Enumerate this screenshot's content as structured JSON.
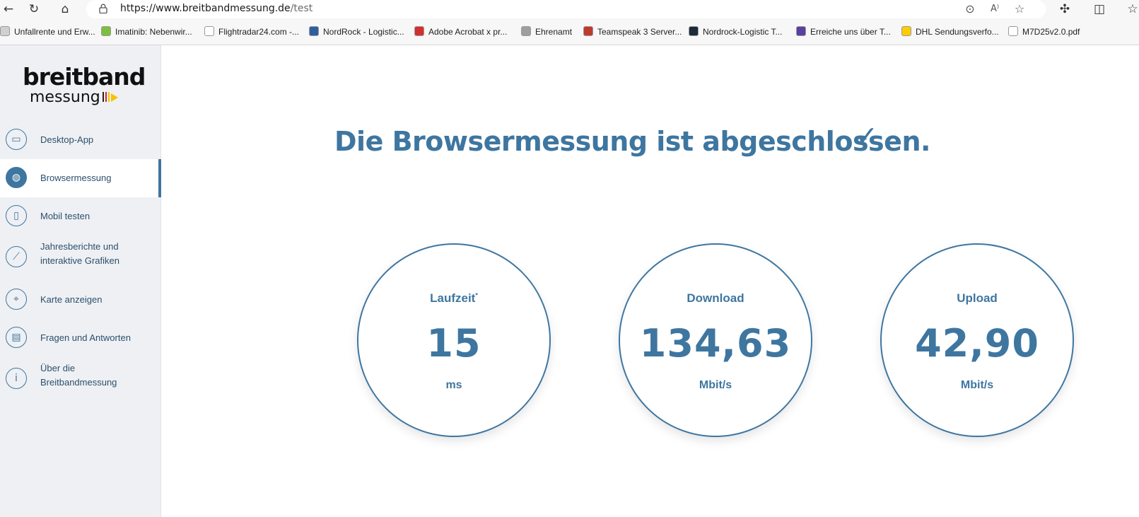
{
  "browser": {
    "url_host": "https://www.breitbandmessung.de",
    "url_path": "/test",
    "bookmarks": [
      {
        "label": "Unfallrente und Erw...",
        "color": "#d0d0d0"
      },
      {
        "label": "Imatinib: Nebenwir...",
        "color": "#7fbf3f"
      },
      {
        "label": "Flightradar24.com -...",
        "color": "#ffffff"
      },
      {
        "label": "NordRock - Logistic...",
        "color": "#2d5fa0"
      },
      {
        "label": "Adobe Acrobat x pr...",
        "color": "#d32f2f"
      },
      {
        "label": "Ehrenamt",
        "color": "#9e9e9e"
      },
      {
        "label": "Teamspeak 3 Server...",
        "color": "#c0392b"
      },
      {
        "label": "Nordrock-Logistic T...",
        "color": "#1b2b3a"
      },
      {
        "label": "Erreiche uns über T...",
        "color": "#5b3fa0"
      },
      {
        "label": "DHL Sendungsverfo...",
        "color": "#ffcc00"
      },
      {
        "label": "M7D25v2.0.pdf",
        "color": "#ffffff"
      }
    ]
  },
  "sidebar": {
    "logo_top": "breitband",
    "logo_bottom": "messung",
    "items": [
      {
        "label": "Desktop-App",
        "icon": "monitor-icon",
        "glyph": "▭",
        "active": false
      },
      {
        "label": "Browsermessung",
        "icon": "globe-icon",
        "glyph": "◍",
        "active": true
      },
      {
        "label": "Mobil testen",
        "icon": "phone-icon",
        "glyph": "▯",
        "active": false
      },
      {
        "label": "Jahresberichte und interaktive Grafiken",
        "icon": "chart-icon",
        "glyph": "⟋",
        "active": false
      },
      {
        "label": "Karte anzeigen",
        "icon": "map-pin-icon",
        "glyph": "⌖",
        "active": false
      },
      {
        "label": "Fragen und Antworten",
        "icon": "chat-icon",
        "glyph": "▤",
        "active": false
      },
      {
        "label": "Über die Breitbandmessung",
        "icon": "info-icon",
        "glyph": "i",
        "active": false
      }
    ]
  },
  "main": {
    "title": "Die Browsermessung ist abgeschlossen.",
    "check": "✓",
    "results": [
      {
        "label": "Laufzeit",
        "marker": "*",
        "value": "15",
        "unit": "ms"
      },
      {
        "label": "Download",
        "marker": "",
        "value": "134,63",
        "unit": "Mbit/s"
      },
      {
        "label": "Upload",
        "marker": "",
        "value": "42,90",
        "unit": "Mbit/s"
      }
    ]
  },
  "colors": {
    "accent": "#3e76a0",
    "sidebar_bg": "#eef0f4"
  }
}
